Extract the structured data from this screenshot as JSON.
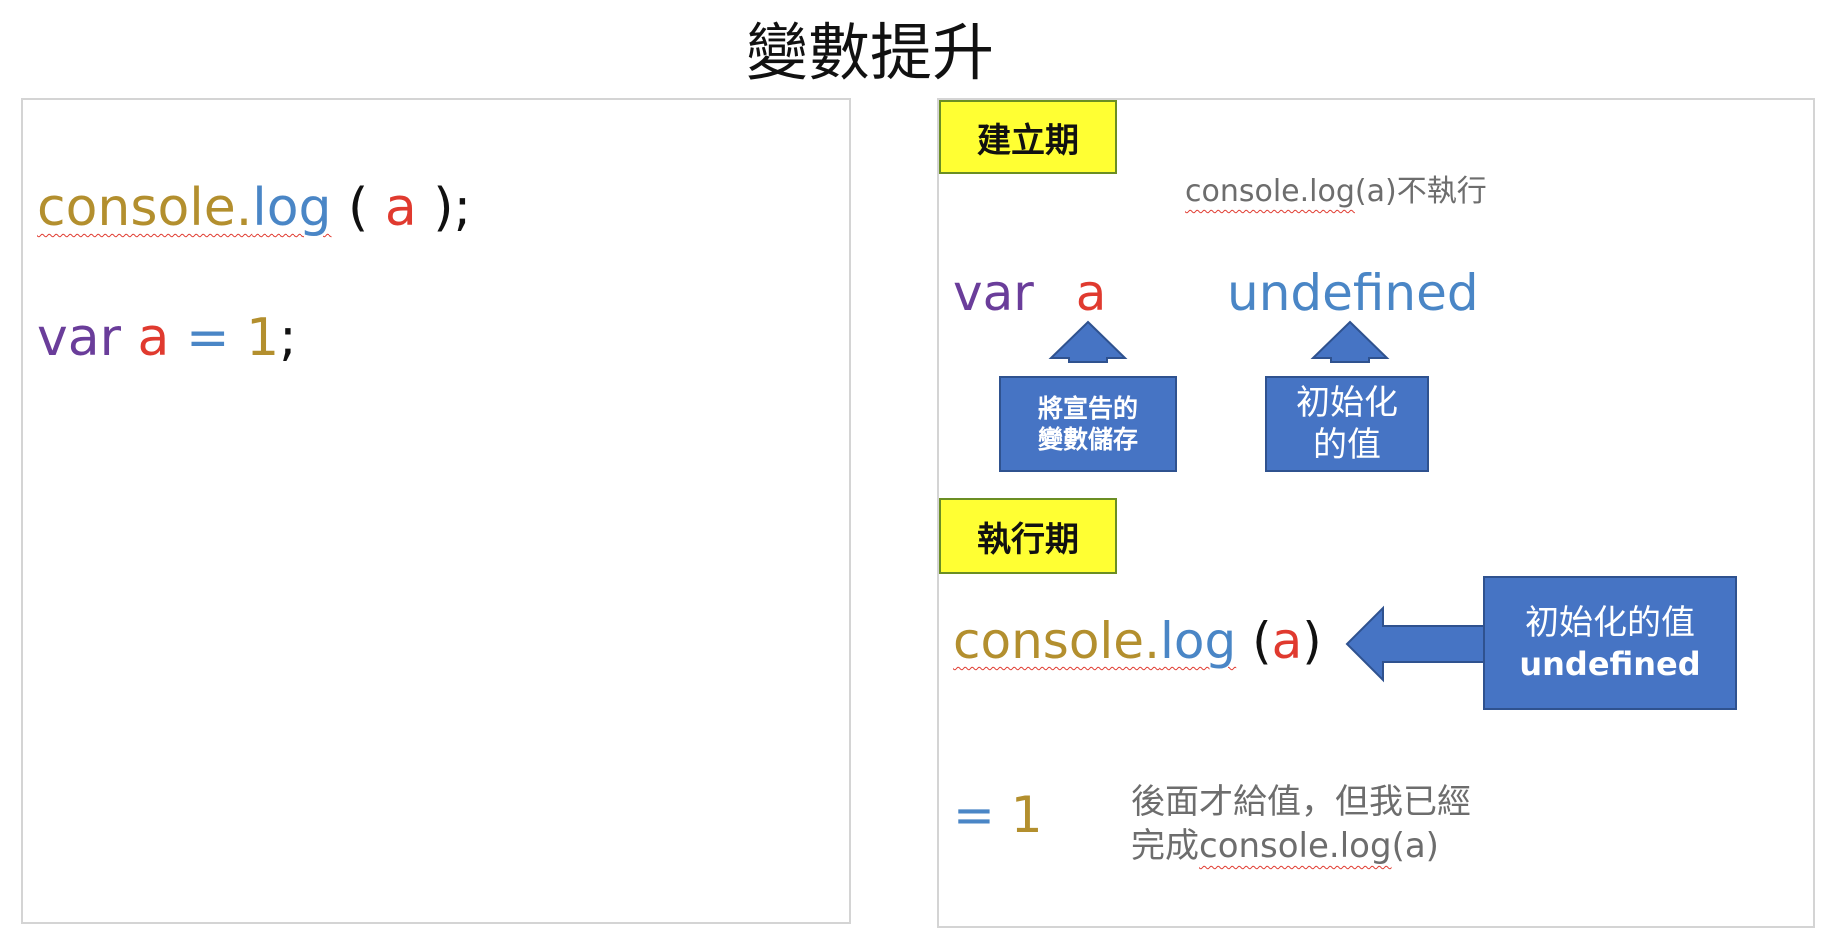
{
  "title": "變數提升",
  "left_code": {
    "line1": {
      "console": "console.",
      "log": "log",
      "open": " ( ",
      "arg": "a",
      "close": " );"
    },
    "line2": {
      "var": "var",
      "name": " a",
      "eq": " = ",
      "value": "1",
      "semi": ";"
    }
  },
  "right": {
    "creation_label": "建立期",
    "creation_note": {
      "code": "console.log",
      "arg": "(a)",
      "suffix": "不執行"
    },
    "declaration": {
      "var": "var",
      "name": "a",
      "value": "undefined"
    },
    "callout_store": {
      "line1": "將宣告的",
      "line2": "變數儲存"
    },
    "callout_init": {
      "line1": "初始化",
      "line2": "的值"
    },
    "execution_label": "執行期",
    "exec_code": {
      "console": "console.",
      "log": "log",
      "open": " (",
      "arg": "a",
      "close": ")"
    },
    "callout_exec": {
      "line1": "初始化的值",
      "line2": "undefined"
    },
    "assign": {
      "eq": "= ",
      "value": "1"
    },
    "assign_note": {
      "line1": "後面才給值，但我已經",
      "line2_prefix": "完成",
      "line2_code": "console.log",
      "line2_arg": "(a)"
    }
  },
  "colors": {
    "gold": "#b38f2e",
    "blue": "#4a86c6",
    "red": "#e03a2f",
    "purple": "#6a3d9a",
    "callout_blue": "#4674c4",
    "label_yellow": "#ffff33"
  }
}
